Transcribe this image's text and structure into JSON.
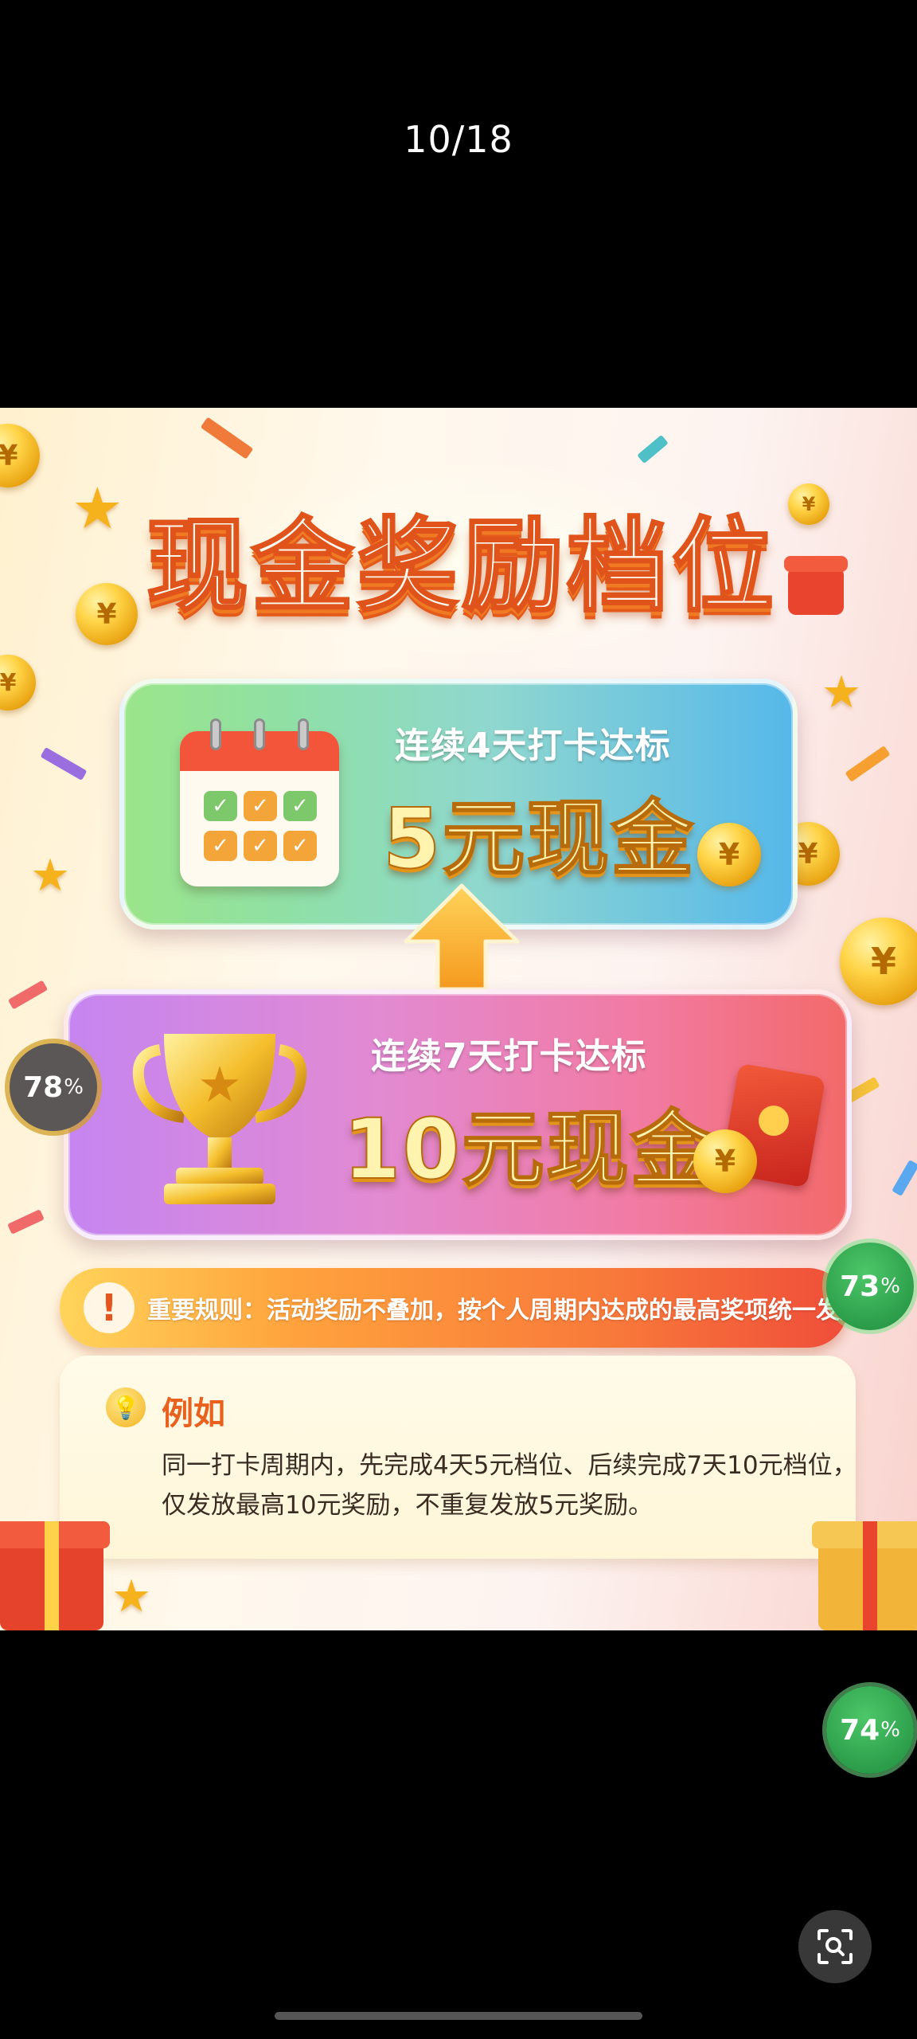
{
  "viewer": {
    "page_counter": "10/18"
  },
  "poster": {
    "title": "现金奖励档位",
    "tier_4day": {
      "condition": "连续4天打卡达标",
      "reward": "5元现金"
    },
    "tier_7day": {
      "condition": "连续7天打卡达标",
      "reward": "10元现金"
    },
    "rule": {
      "icon": "!",
      "text": "重要规则：活动奖励不叠加，按个人周期内达成的最高奖项统一发放"
    },
    "example": {
      "title": "例如",
      "line1": "同一打卡周期内，先完成4天5元档位、后续完成7天10元档位，",
      "line2": "仅发放最高10元奖励，不重复发放5元奖励。"
    },
    "coin_symbol": "¥"
  },
  "overlay_badges": {
    "left_value": "78",
    "right_top_value": "73",
    "right_bottom_value": "74",
    "unit": "%"
  },
  "icons": [
    "calendar-icon",
    "trophy-icon",
    "up-arrow-icon",
    "red-envelope-icon",
    "coin-icon",
    "star-icon",
    "gift-icon",
    "lightbulb-icon",
    "exclamation-icon",
    "lens-search-icon"
  ],
  "colors": {
    "title_stroke": "#e0541c",
    "tier1_start": "#9be58a",
    "tier1_end": "#56b8ea",
    "tier2_start": "#c585f0",
    "tier2_end": "#f26a6a",
    "rule_start": "#ffd45a",
    "rule_end": "#ef4d3a",
    "example_title": "#e8611e",
    "badge_green": "#2aa84b",
    "badge_gray": "#5b5756"
  }
}
